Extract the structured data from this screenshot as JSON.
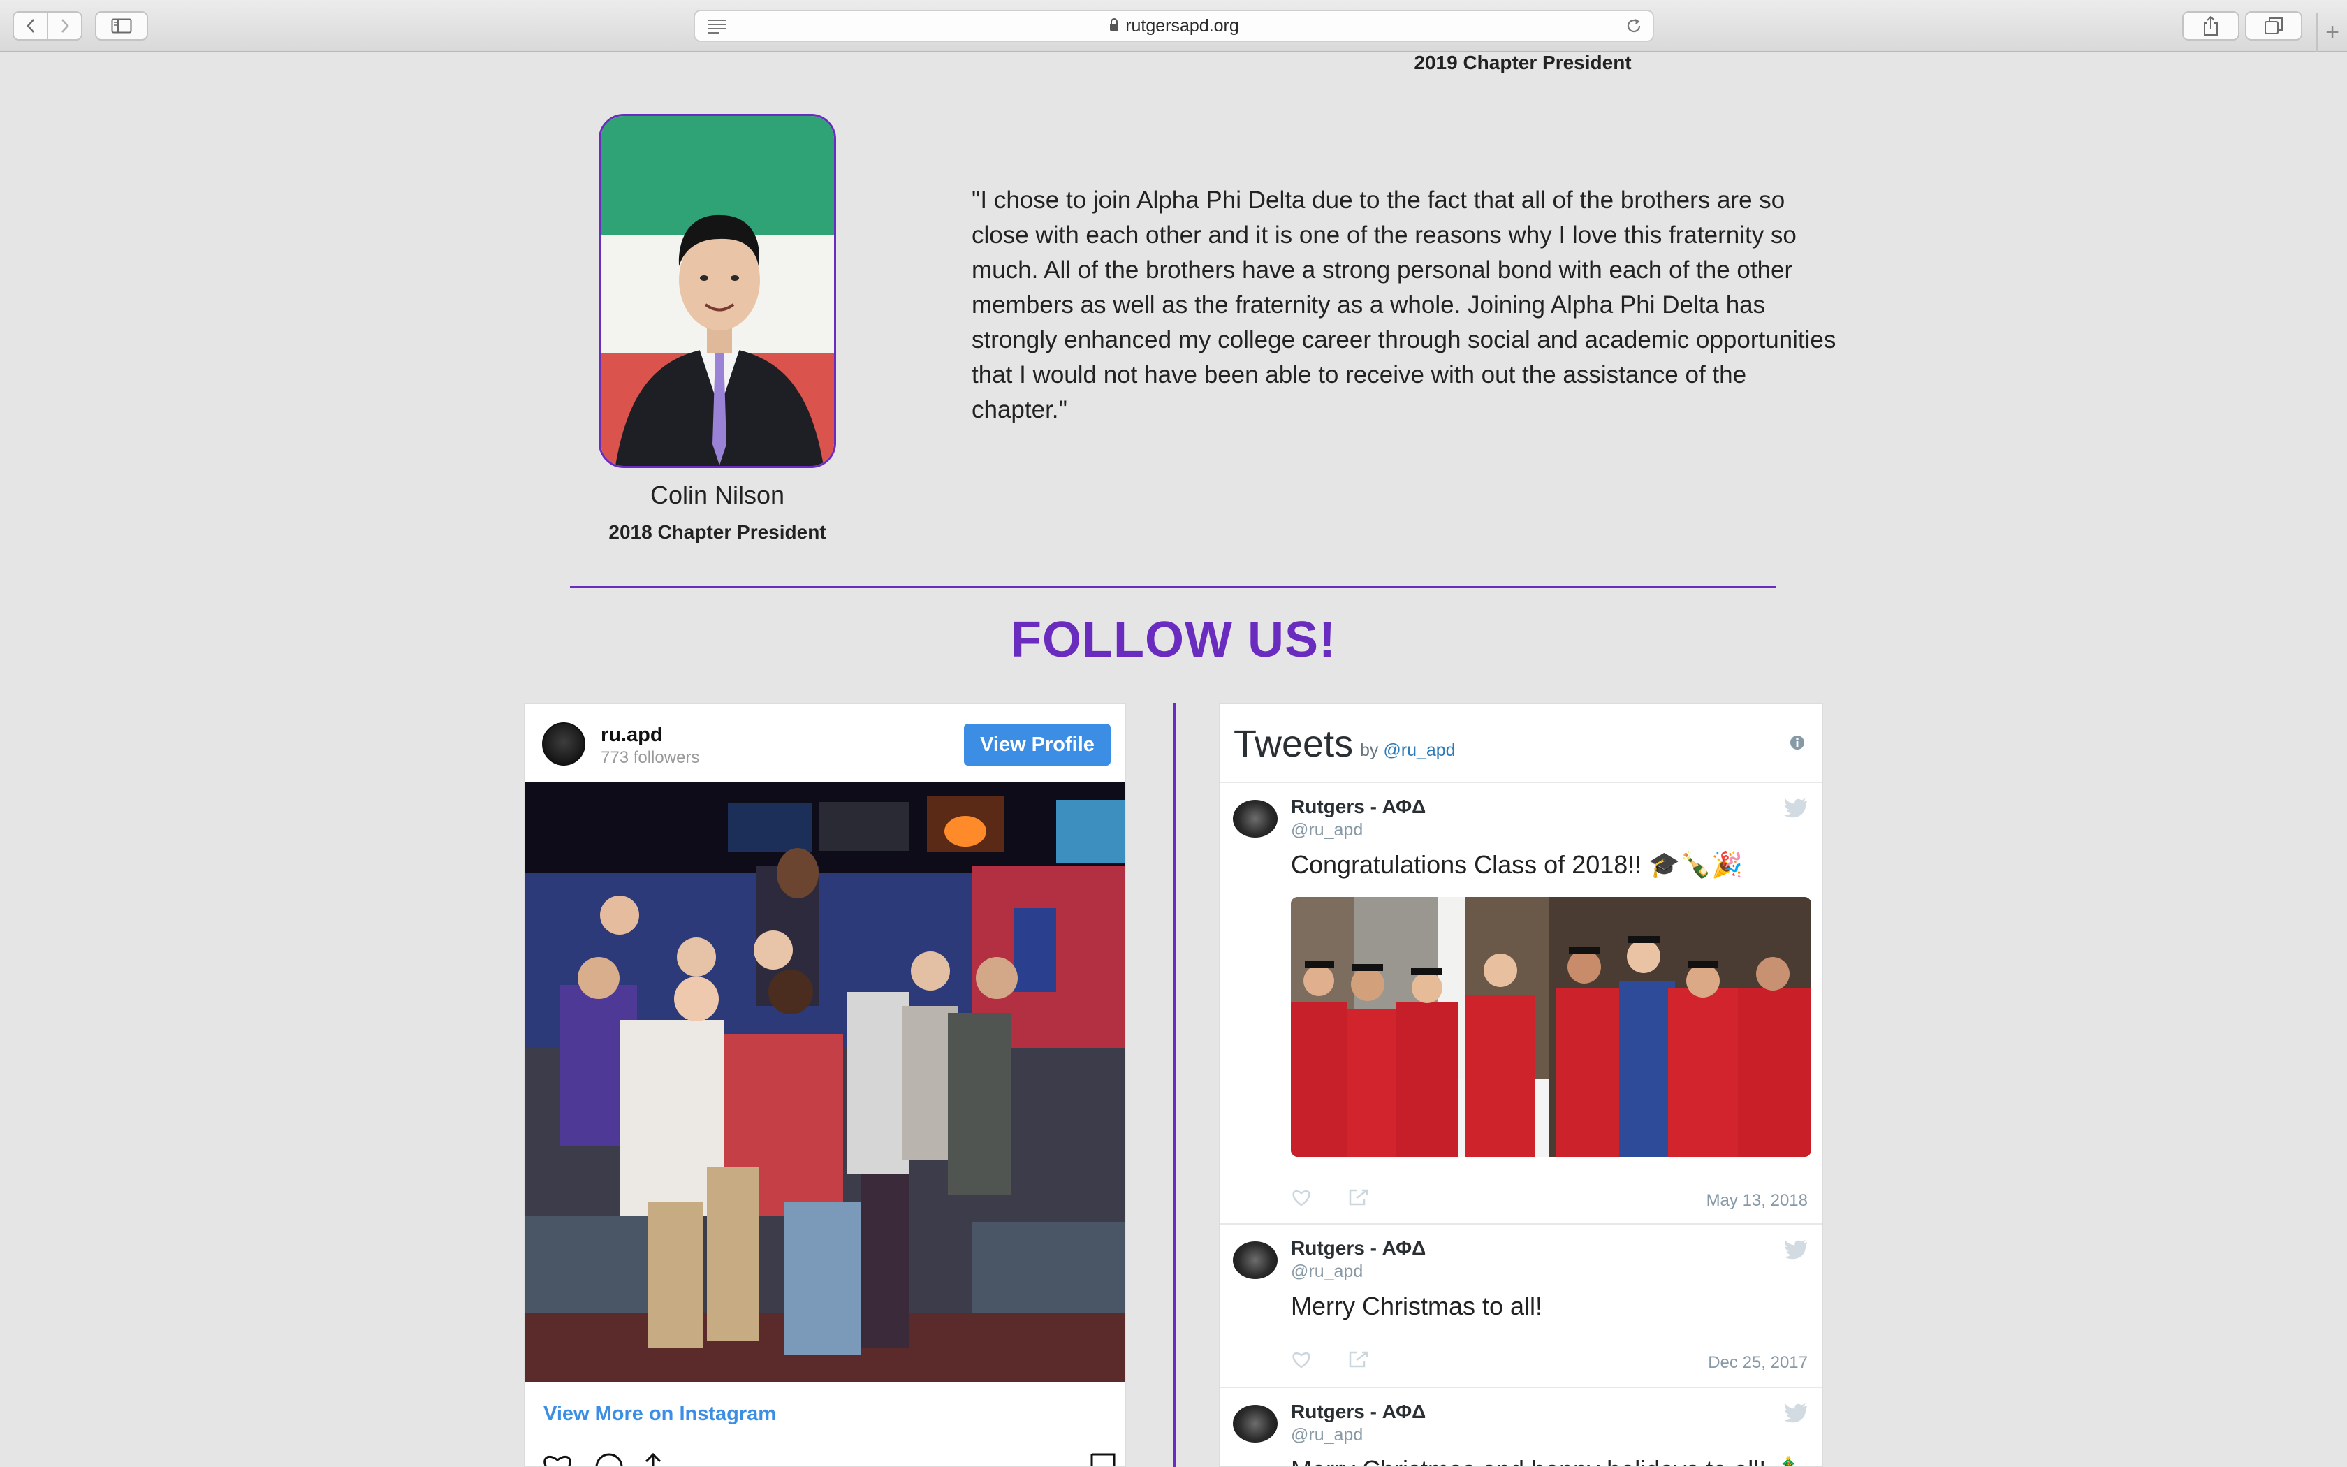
{
  "browser": {
    "url": "rutgersapd.org"
  },
  "page": {
    "previous_title": "2019 Chapter President",
    "president": {
      "name": "Colin Nilson",
      "title": "2018 Chapter President",
      "quote": "\"I chose to join Alpha Phi Delta due to the fact that all of the brothers are so close with each other and it is one of the reasons why I love this fraternity so much.  All of the brothers have a strong personal bond with each of the other members as well as the fraternity as a whole.  Joining Alpha Phi Delta has strongly enhanced my college career through social and academic opportunities that I would not have been able to receive with out the assistance of the chapter.\""
    },
    "follow_heading": "FOLLOW US!"
  },
  "instagram": {
    "handle": "ru.apd",
    "followers": "773 followers",
    "view_profile": "View Profile",
    "view_more": "View More on Instagram"
  },
  "twitter": {
    "title": "Tweets",
    "by": "by",
    "handle": "@ru_apd",
    "tweets": [
      {
        "name": "Rutgers - ΑΦΔ",
        "user": "@ru_apd",
        "text": "Congratulations Class of 2018!! 🎓🍾🎉",
        "date": "May 13, 2018"
      },
      {
        "name": "Rutgers - ΑΦΔ",
        "user": "@ru_apd",
        "text": "Merry Christmas to all!",
        "date": "Dec 25, 2017"
      },
      {
        "name": "Rutgers - ΑΦΔ",
        "user": "@ru_apd",
        "text": "Merry Christmas and happy holidays to all! 🎄"
      }
    ]
  },
  "colors": {
    "accent": "#6a2bbf",
    "instagram_blue": "#3c8ee4",
    "twitter_link": "#2b7bb9"
  }
}
